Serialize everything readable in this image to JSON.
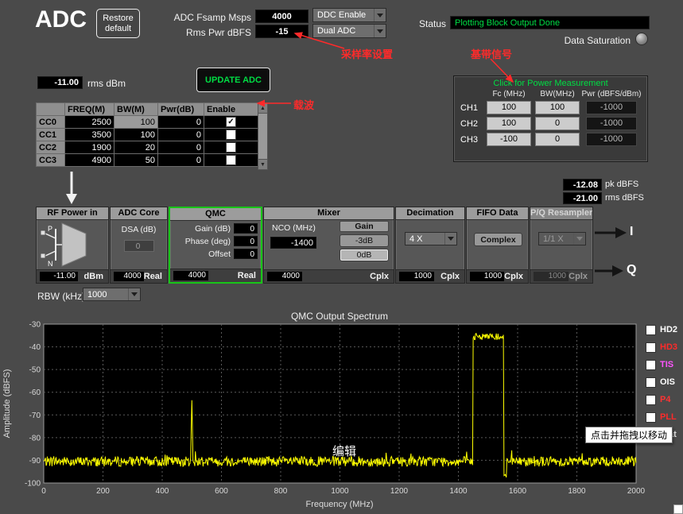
{
  "colors": {
    "trace": "#ffff00",
    "status_green": "#00dd44",
    "annotation_red": "#ff2a2a"
  },
  "header": {
    "title": "ADC",
    "restore_line1": "Restore",
    "restore_line2": "default",
    "fsamp_label": "ADC Fsamp Msps",
    "fsamp_value": "4000",
    "rmspwr_label": "Rms Pwr dBFS",
    "rmspwr_value": "-15",
    "ddc_enable": "DDC Enable",
    "adc_mode": "Dual ADC",
    "status_label": "Status",
    "status_value": "Plotting Block Output Done",
    "data_saturation_label": "Data Saturation"
  },
  "annotations": {
    "sample_rate_note": "采样率设置",
    "baseband_note": "基带信号",
    "carrier_note": "载波",
    "edit_note": "编辑",
    "drag_tooltip": "点击并拖拽以移动"
  },
  "carrier_panel": {
    "rms_dbm_value": "-11.00",
    "rms_dbm_label": "rms dBm",
    "update_button": "UPDATE ADC",
    "table": {
      "headers": [
        "FREQ(M)",
        "BW(M)",
        "Pwr(dB)",
        "Enable"
      ],
      "rows": [
        {
          "name": "CC0",
          "freq": "2500",
          "bw": "100",
          "pwr": "0",
          "enable": true
        },
        {
          "name": "CC1",
          "freq": "3500",
          "bw": "100",
          "pwr": "0",
          "enable": false
        },
        {
          "name": "CC2",
          "freq": "1900",
          "bw": "20",
          "pwr": "0",
          "enable": false
        },
        {
          "name": "CC3",
          "freq": "4900",
          "bw": "50",
          "pwr": "0",
          "enable": false
        }
      ]
    }
  },
  "power_panel": {
    "title": "Click for Power Measurement",
    "col_headers": [
      "Fc (MHz)",
      "BW(MHz)",
      "Pwr (dBFS/dBm)"
    ],
    "rows": [
      {
        "name": "CH1",
        "fc": "100",
        "bw": "100",
        "pwr": "-1000"
      },
      {
        "name": "CH2",
        "fc": "100",
        "bw": "0",
        "pwr": "-1000"
      },
      {
        "name": "CH3",
        "fc": "-100",
        "bw": "0",
        "pwr": "-1000"
      }
    ]
  },
  "readouts": {
    "pk_value": "-12.08",
    "pk_label": "pk dBFS",
    "rms_value": "-21.00",
    "rms_label": "rms dBFS"
  },
  "chain": {
    "rf": {
      "title": "RF Power in",
      "p_label": "P",
      "n_label": "N",
      "value": "-11.00",
      "unit": "dBm"
    },
    "adc_core": {
      "title": "ADC Core",
      "dsa_label": "DSA (dB)",
      "dsa_value": "0",
      "rate": "4000",
      "fmt": "Real"
    },
    "qmc": {
      "title": "QMC",
      "gain_label": "Gain (dB)",
      "gain_value": "0",
      "phase_label": "Phase (deg)",
      "phase_value": "0",
      "offset_label": "Offset",
      "offset_value": "0",
      "rate": "4000",
      "fmt": "Real"
    },
    "mixer": {
      "title": "Mixer",
      "nco_label": "NCO (MHz)",
      "nco_value": "-1400",
      "gain_label": "Gain",
      "minus3db": "-3dB",
      "zerodb": "0dB",
      "rate": "4000",
      "fmt": "Cplx"
    },
    "decimation": {
      "title": "Decimation",
      "value": "4 X",
      "rate": "1000",
      "fmt": "Cplx"
    },
    "fifo": {
      "title": "FIFO Data",
      "value": "Complex",
      "rate": "1000",
      "fmt": "Cplx"
    },
    "resampler": {
      "title": "P/Q Resampler",
      "value": "1/1 X",
      "rate": "1000",
      "fmt": "Cplx"
    },
    "i_label": "I",
    "q_label": "Q"
  },
  "rbw": {
    "label": "RBW (kHz)",
    "value": "1000"
  },
  "chart_data": {
    "type": "line",
    "title": "QMC Output Spectrum",
    "xlabel": "Frequency (MHz)",
    "ylabel": "Amplitude (dBFS)",
    "xlim": [
      0,
      2000
    ],
    "ylim": [
      -100,
      -30
    ],
    "x_ticks": [
      0,
      200,
      400,
      600,
      800,
      1000,
      1200,
      1400,
      1600,
      1800,
      2000
    ],
    "y_ticks": [
      -30,
      -40,
      -50,
      -60,
      -70,
      -80,
      -90,
      -100
    ],
    "grid": true,
    "legend_position": "right",
    "series": [
      {
        "name": "QMC output spectrum",
        "color": "#ffff00",
        "noise_floor": -90.5,
        "noise_var": 2.2,
        "features": [
          {
            "type": "spur",
            "x": 500,
            "peak": -63.5
          },
          {
            "type": "band",
            "x_start": 1449,
            "x_end": 1552,
            "level": -35.5,
            "ripple": 1.5
          },
          {
            "type": "notch",
            "x_start": 1553,
            "x_end": 1562,
            "level": -97
          }
        ],
        "key_points": [
          [
            0,
            -90
          ],
          [
            500,
            -63.5
          ],
          [
            1000,
            -90
          ],
          [
            1448,
            -90
          ],
          [
            1450,
            -35.5
          ],
          [
            1550,
            -35.5
          ],
          [
            1558,
            -97
          ],
          [
            1570,
            -90
          ],
          [
            2000,
            -90
          ]
        ]
      }
    ],
    "legend": [
      {
        "label": "HD2",
        "color": "#ffffff"
      },
      {
        "label": "HD3",
        "color": "#ff2a2a"
      },
      {
        "label": "TIS",
        "color": "#ff55ff"
      },
      {
        "label": "OIS",
        "color": "#ffffff"
      },
      {
        "label": "P4",
        "color": "#ff3333"
      },
      {
        "label": "PLL",
        "color": "#ff2a2a"
      },
      {
        "label": "Stat",
        "color": "#e8e8e8"
      }
    ]
  }
}
